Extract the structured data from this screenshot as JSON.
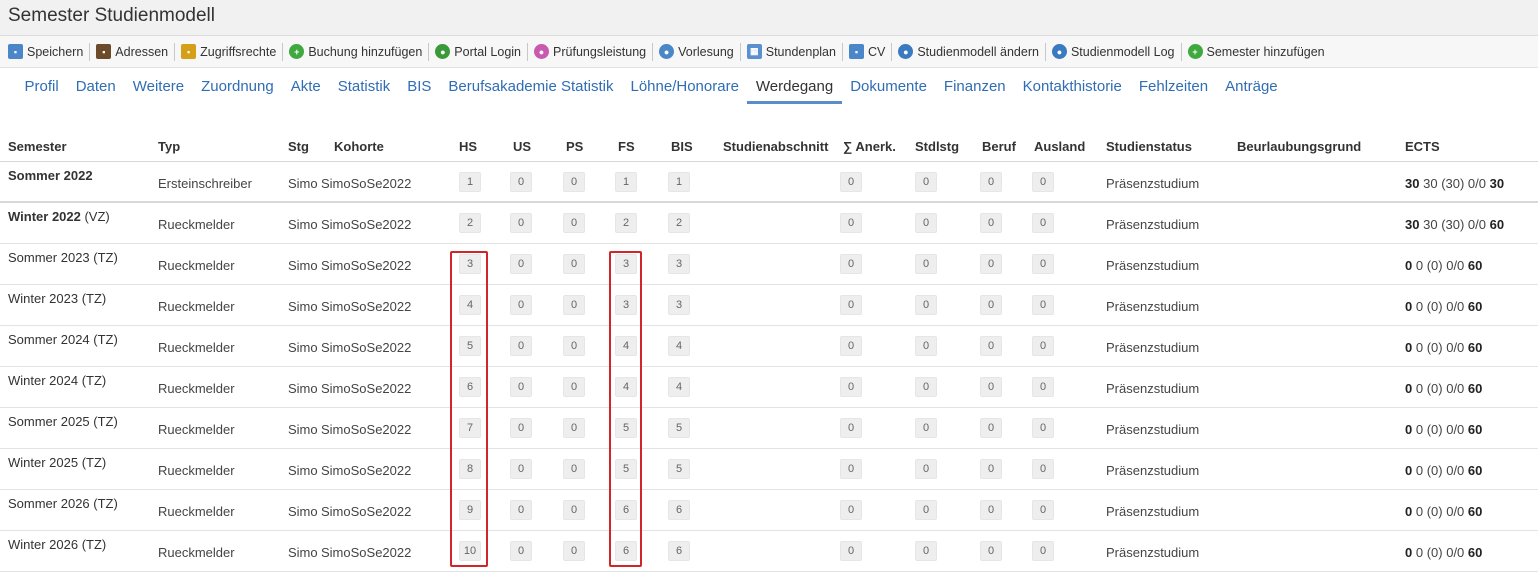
{
  "window": {
    "title": "Semester Studienmodell"
  },
  "toolbar": {
    "items": [
      {
        "label": "Speichern",
        "icon": "save-icon",
        "color": "#4a86c8",
        "glyph": "▪"
      },
      {
        "label": "Adressen",
        "icon": "address-book-icon",
        "color": "#6b4b2a",
        "glyph": "▪"
      },
      {
        "label": "Zugriffsrechte",
        "icon": "lock-icon",
        "color": "#d4a017",
        "glyph": "▪"
      },
      {
        "label": "Buchung hinzufügen",
        "icon": "add-icon",
        "color": "#3fa83f",
        "glyph": "+"
      },
      {
        "label": "Portal Login",
        "icon": "globe-icon",
        "color": "#3a9a3a",
        "glyph": "●"
      },
      {
        "label": "Prüfungsleistung",
        "icon": "badge-icon",
        "color": "#c85ab0",
        "glyph": "●"
      },
      {
        "label": "Vorlesung",
        "icon": "presentation-icon",
        "color": "#4a86c8",
        "glyph": "●"
      },
      {
        "label": "Stundenplan",
        "icon": "calendar-icon",
        "color": "#5a8fd0",
        "glyph": "▦"
      },
      {
        "label": "CV",
        "icon": "document-icon",
        "color": "#4a86c8",
        "glyph": "▪"
      },
      {
        "label": "Studienmodell ändern",
        "icon": "gear-icon",
        "color": "#3a7ac0",
        "glyph": "●"
      },
      {
        "label": "Studienmodell Log",
        "icon": "log-icon",
        "color": "#3a7ac0",
        "glyph": "●"
      },
      {
        "label": "Semester hinzufügen",
        "icon": "add-icon",
        "color": "#3fa83f",
        "glyph": "+"
      }
    ]
  },
  "tabs": [
    "Profil",
    "Daten",
    "Weitere",
    "Zuordnung",
    "Akte",
    "Statistik",
    "BIS",
    "Berufsakademie Statistik",
    "Löhne/Honorare",
    "Werdegang",
    "Dokumente",
    "Finanzen",
    "Kontakthistorie",
    "Fehlzeiten",
    "Anträge"
  ],
  "active_tab": "Werdegang",
  "table": {
    "headers": {
      "semester": "Semester",
      "typ": "Typ",
      "stg": "Stg",
      "kohorte": "Kohorte",
      "hs": "HS",
      "us": "US",
      "ps": "PS",
      "fs": "FS",
      "bis": "BIS",
      "studienabschnitt": "Studienabschnitt",
      "anerk": "∑ Anerk.",
      "stdlstg": "Stdlstg",
      "beruf": "Beruf",
      "ausland": "Ausland",
      "studienstatus": "Studienstatus",
      "beurlaubungsgrund": "Beurlaubungsgrund",
      "ects": "ECTS"
    },
    "rows": [
      {
        "sem": "Sommer 2022",
        "suffix": "",
        "bold": true,
        "typ": "Ersteinschreiber",
        "stg": "Simo",
        "kohorte": "SimoSoSe2022",
        "hs": "1",
        "us": "0",
        "ps": "0",
        "fs": "1",
        "bis": "1",
        "anerk": "0",
        "stdlstg": "0",
        "beruf": "0",
        "ausland": "0",
        "status": "Präsenzstudium",
        "ects_a": "30",
        "ects_b": "30",
        "ects_c": "(30) 0/0",
        "ects_d": "30"
      },
      {
        "sem": "Winter 2022",
        "suffix": " (VZ)",
        "bold": true,
        "typ": "Rueckmelder",
        "stg": "Simo",
        "kohorte": "SimoSoSe2022",
        "hs": "2",
        "us": "0",
        "ps": "0",
        "fs": "2",
        "bis": "2",
        "anerk": "0",
        "stdlstg": "0",
        "beruf": "0",
        "ausland": "0",
        "status": "Präsenzstudium",
        "ects_a": "30",
        "ects_b": "30",
        "ects_c": "(30) 0/0",
        "ects_d": "60"
      },
      {
        "sem": "Sommer 2023 (TZ)",
        "suffix": "",
        "bold": false,
        "typ": "Rueckmelder",
        "stg": "Simo",
        "kohorte": "SimoSoSe2022",
        "hs": "3",
        "us": "0",
        "ps": "0",
        "fs": "3",
        "bis": "3",
        "anerk": "0",
        "stdlstg": "0",
        "beruf": "0",
        "ausland": "0",
        "status": "Präsenzstudium",
        "ects_a": "0",
        "ects_b": "0",
        "ects_c": "(0) 0/0",
        "ects_d": "60"
      },
      {
        "sem": "Winter 2023 (TZ)",
        "suffix": "",
        "bold": false,
        "typ": "Rueckmelder",
        "stg": "Simo",
        "kohorte": "SimoSoSe2022",
        "hs": "4",
        "us": "0",
        "ps": "0",
        "fs": "3",
        "bis": "3",
        "anerk": "0",
        "stdlstg": "0",
        "beruf": "0",
        "ausland": "0",
        "status": "Präsenzstudium",
        "ects_a": "0",
        "ects_b": "0",
        "ects_c": "(0) 0/0",
        "ects_d": "60"
      },
      {
        "sem": "Sommer 2024 (TZ)",
        "suffix": "",
        "bold": false,
        "typ": "Rueckmelder",
        "stg": "Simo",
        "kohorte": "SimoSoSe2022",
        "hs": "5",
        "us": "0",
        "ps": "0",
        "fs": "4",
        "bis": "4",
        "anerk": "0",
        "stdlstg": "0",
        "beruf": "0",
        "ausland": "0",
        "status": "Präsenzstudium",
        "ects_a": "0",
        "ects_b": "0",
        "ects_c": "(0) 0/0",
        "ects_d": "60"
      },
      {
        "sem": "Winter 2024 (TZ)",
        "suffix": "",
        "bold": false,
        "typ": "Rueckmelder",
        "stg": "Simo",
        "kohorte": "SimoSoSe2022",
        "hs": "6",
        "us": "0",
        "ps": "0",
        "fs": "4",
        "bis": "4",
        "anerk": "0",
        "stdlstg": "0",
        "beruf": "0",
        "ausland": "0",
        "status": "Präsenzstudium",
        "ects_a": "0",
        "ects_b": "0",
        "ects_c": "(0) 0/0",
        "ects_d": "60"
      },
      {
        "sem": "Sommer 2025 (TZ)",
        "suffix": "",
        "bold": false,
        "typ": "Rueckmelder",
        "stg": "Simo",
        "kohorte": "SimoSoSe2022",
        "hs": "7",
        "us": "0",
        "ps": "0",
        "fs": "5",
        "bis": "5",
        "anerk": "0",
        "stdlstg": "0",
        "beruf": "0",
        "ausland": "0",
        "status": "Präsenzstudium",
        "ects_a": "0",
        "ects_b": "0",
        "ects_c": "(0) 0/0",
        "ects_d": "60"
      },
      {
        "sem": "Winter 2025 (TZ)",
        "suffix": "",
        "bold": false,
        "typ": "Rueckmelder",
        "stg": "Simo",
        "kohorte": "SimoSoSe2022",
        "hs": "8",
        "us": "0",
        "ps": "0",
        "fs": "5",
        "bis": "5",
        "anerk": "0",
        "stdlstg": "0",
        "beruf": "0",
        "ausland": "0",
        "status": "Präsenzstudium",
        "ects_a": "0",
        "ects_b": "0",
        "ects_c": "(0) 0/0",
        "ects_d": "60"
      },
      {
        "sem": "Sommer 2026 (TZ)",
        "suffix": "",
        "bold": false,
        "typ": "Rueckmelder",
        "stg": "Simo",
        "kohorte": "SimoSoSe2022",
        "hs": "9",
        "us": "0",
        "ps": "0",
        "fs": "6",
        "bis": "6",
        "anerk": "0",
        "stdlstg": "0",
        "beruf": "0",
        "ausland": "0",
        "status": "Präsenzstudium",
        "ects_a": "0",
        "ects_b": "0",
        "ects_c": "(0) 0/0",
        "ects_d": "60"
      },
      {
        "sem": "Winter 2026 (TZ)",
        "suffix": "",
        "bold": false,
        "typ": "Rueckmelder",
        "stg": "Simo",
        "kohorte": "SimoSoSe2022",
        "hs": "10",
        "us": "0",
        "ps": "0",
        "fs": "6",
        "bis": "6",
        "anerk": "0",
        "stdlstg": "0",
        "beruf": "0",
        "ausland": "0",
        "status": "Präsenzstudium",
        "ects_a": "0",
        "ects_b": "0",
        "ects_c": "(0) 0/0",
        "ects_d": "60"
      }
    ]
  },
  "highlight_color": "#d0262a"
}
